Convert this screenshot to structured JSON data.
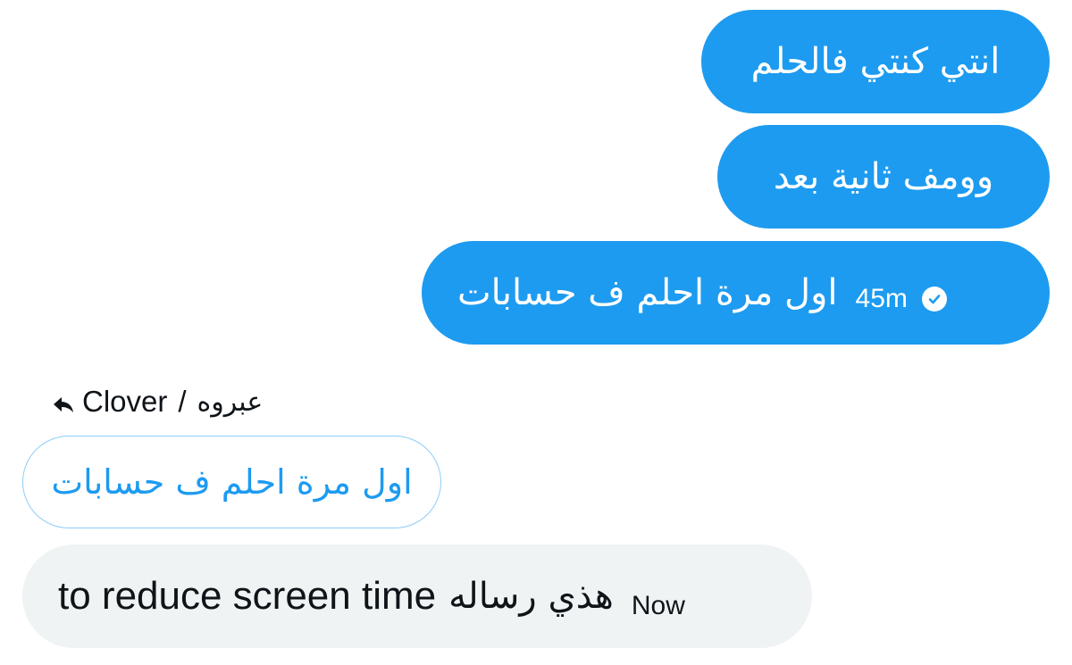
{
  "conversation": {
    "outgoing": [
      {
        "text": "انتي كنتي فالحلم"
      },
      {
        "text": "وومف ثانية بعد"
      },
      {
        "text": "اول مرة احلم ف حسابات",
        "time": "45m",
        "status_icon": "check-circle-icon"
      }
    ],
    "reply_context": {
      "icon": "reply-arrow-icon",
      "author": "Clover",
      "separator": "/",
      "action": "عبروه"
    },
    "quoted_message": {
      "text": "اول مرة احلم ف حسابات"
    },
    "incoming": {
      "text_en": "to reduce screen time",
      "text_ar": "هذي رساله",
      "time": "Now"
    }
  },
  "colors": {
    "outgoing_bubble": "#1d9bf0",
    "incoming_bubble": "#eff3f4",
    "quoted_border": "#8ecdf7",
    "text_dark": "#0f1419"
  }
}
